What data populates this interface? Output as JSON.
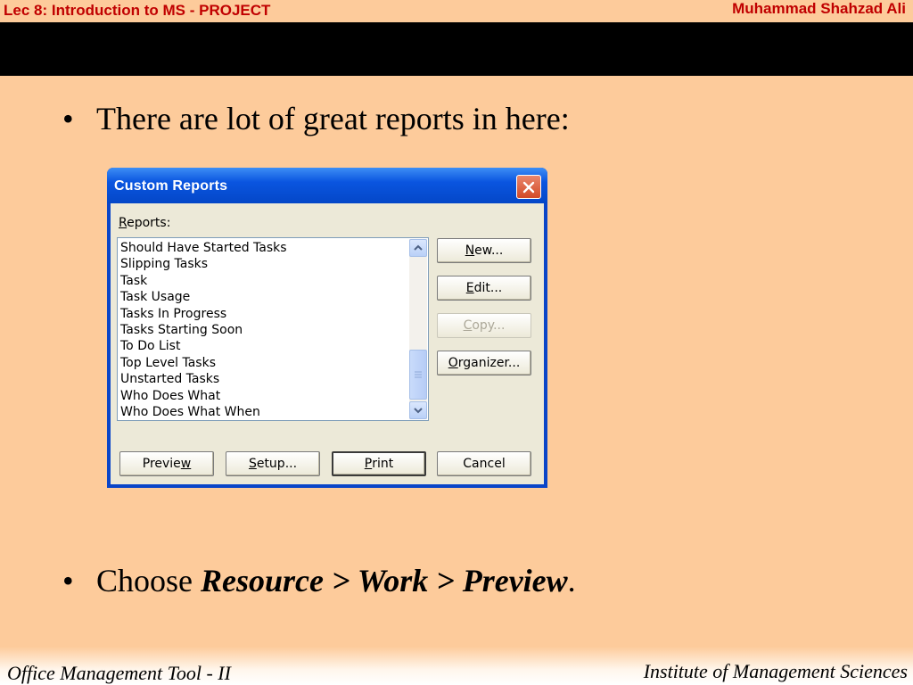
{
  "slide": {
    "header_left": "Lec 8: Introduction to MS - PROJECT",
    "header_right": "Muhammad Shahzad Ali",
    "bullet_marker": "•",
    "bullet1": "There are lot of great reports in here:",
    "bullet2_prefix": "Choose ",
    "bullet2_emphasis": "Resource > Work > Preview",
    "bullet2_suffix": ".",
    "footer_left": "Office Management Tool - II",
    "footer_right": "Institute of Management Sciences"
  },
  "dialog": {
    "title": "Custom Reports",
    "close_icon": "close-icon",
    "reports_label": {
      "key": "R",
      "rest": "eports:"
    },
    "reports": [
      "Should Have Started Tasks",
      "Slipping Tasks",
      "Task",
      "Task Usage",
      "Tasks In Progress",
      "Tasks Starting Soon",
      "To Do List",
      "Top Level Tasks",
      "Unstarted Tasks",
      "Who Does What",
      "Who Does What When"
    ],
    "side_buttons": {
      "new": {
        "key": "N",
        "rest": "ew..."
      },
      "edit": {
        "key": "E",
        "rest": "dit..."
      },
      "copy": {
        "key": "C",
        "rest": "opy..."
      },
      "organizer": {
        "key": "O",
        "rest": "rganizer..."
      }
    },
    "bottom_buttons": {
      "preview": {
        "pre": "Previe",
        "key": "w"
      },
      "setup": {
        "key": "S",
        "rest": "etup..."
      },
      "print": {
        "key": "P",
        "rest": "rint"
      },
      "cancel": "Cancel"
    },
    "colors": {
      "title_bar": "#0a55e0",
      "face": "#ece9d8",
      "close": "#d34a27",
      "slide_bg": "#fdcb9b",
      "header_text": "#c00000"
    }
  }
}
